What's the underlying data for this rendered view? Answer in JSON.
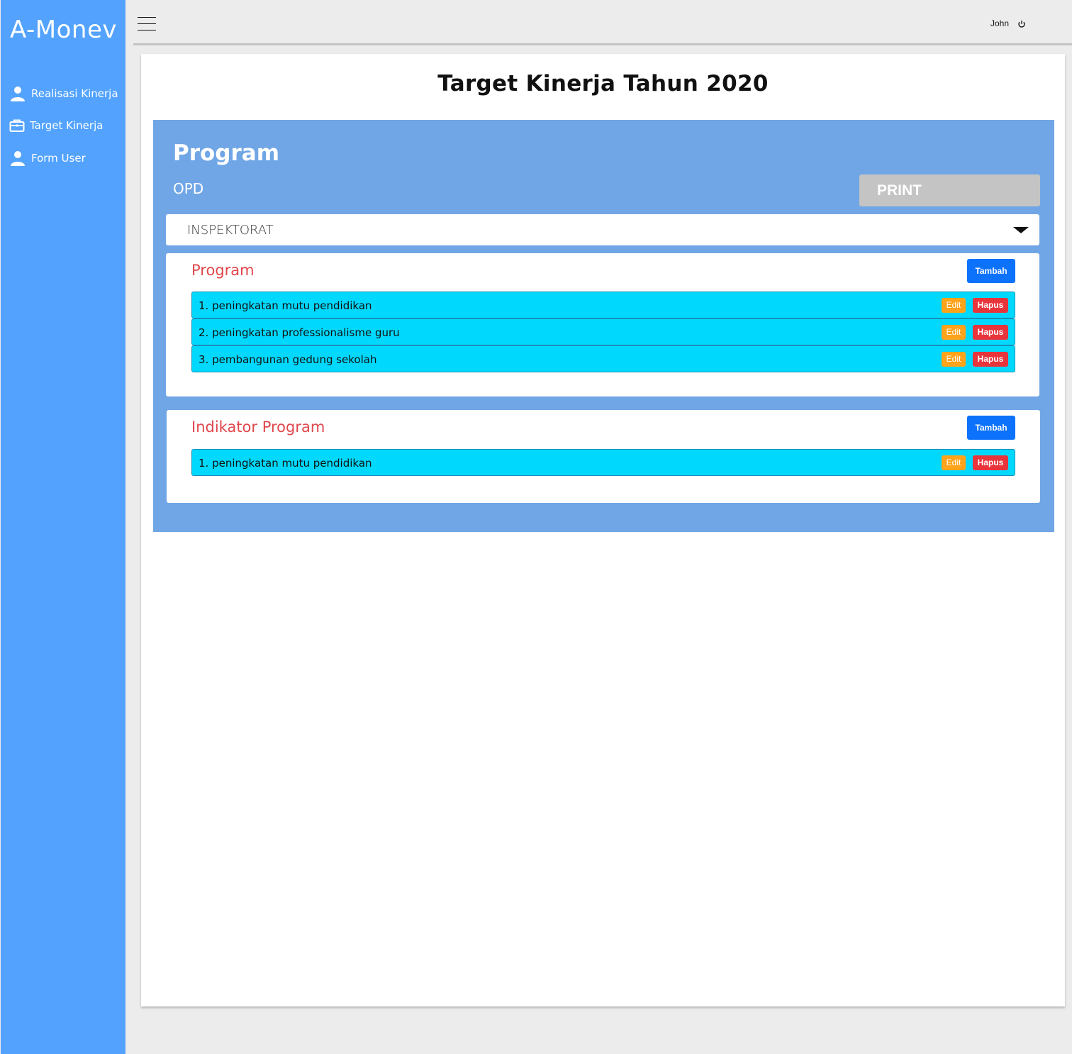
{
  "app": {
    "brand": "A-Monev"
  },
  "sidebar": {
    "items": [
      {
        "label": "Realisasi Kinerja",
        "icon": "user-icon"
      },
      {
        "label": "Target Kinerja",
        "icon": "briefcase-icon"
      },
      {
        "label": "Form User",
        "icon": "user-icon"
      }
    ]
  },
  "topbar": {
    "user_name": "John",
    "logout_icon": "power-icon"
  },
  "page": {
    "title": "Target Kinerja Tahun 2020"
  },
  "panel": {
    "title": "Program",
    "opd_label": "OPD",
    "print_label": "PRINT",
    "opd_selected": "INSPEKTORAT"
  },
  "program_box": {
    "title": "Program",
    "add_label": "Tambah",
    "edit_label": "Edit",
    "delete_label": "Hapus",
    "rows": [
      "1. peningkatan mutu pendidikan",
      "2. peningkatan professionalisme guru",
      "3. pembangunan gedung sekolah"
    ]
  },
  "indikator_box": {
    "title": "Indikator Program",
    "add_label": "Tambah",
    "edit_label": "Edit",
    "delete_label": "Hapus",
    "rows": [
      "1. peningkatan mutu pendidikan"
    ]
  },
  "colors": {
    "sidebar": "#53a3fe",
    "panel": "#70a6e5",
    "row": "#00d9fd",
    "add_button": "#0c72fb",
    "edit_button": "#ffa31a",
    "delete_button": "#e8343b",
    "box_title": "#e0474c"
  }
}
